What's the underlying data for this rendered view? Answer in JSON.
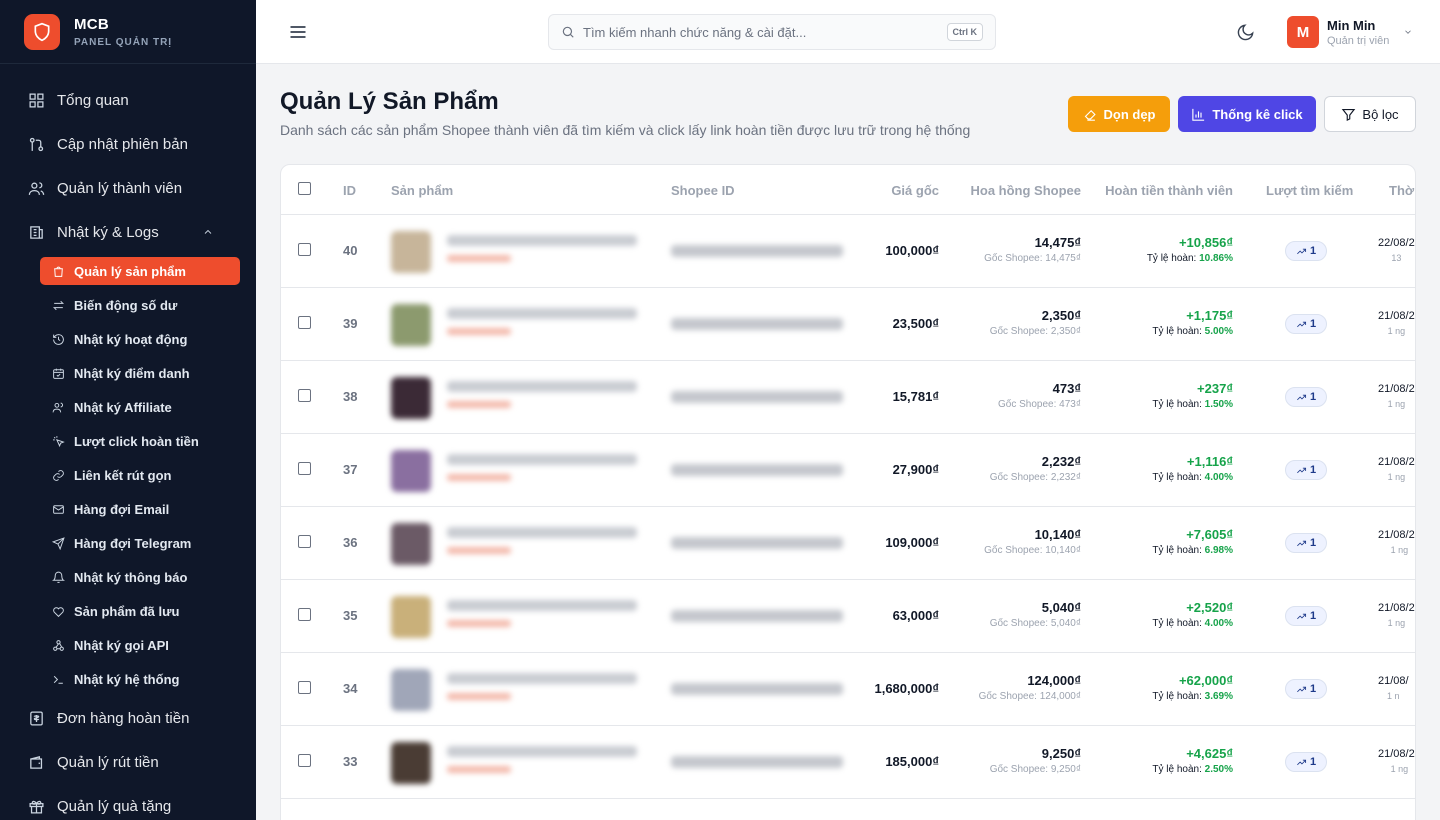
{
  "brand": {
    "name": "MCB",
    "subtitle": "PANEL QUẢN TRỊ"
  },
  "sidebar": {
    "items": [
      {
        "label": "Tổng quan",
        "icon": "dashboard-icon"
      },
      {
        "label": "Cập nhật phiên bản",
        "icon": "git-icon"
      },
      {
        "label": "Quản lý thành viên",
        "icon": "users-icon"
      },
      {
        "label": "Nhật ký & Logs",
        "icon": "logs-icon",
        "expanded": true
      }
    ],
    "sub_items": [
      {
        "label": "Quản lý sản phẩm",
        "icon": "shopping-bag-icon",
        "active": true
      },
      {
        "label": "Biến động số dư",
        "icon": "arrows-icon"
      },
      {
        "label": "Nhật ký hoạt động",
        "icon": "history-icon"
      },
      {
        "label": "Nhật ký điểm danh",
        "icon": "calendar-check-icon"
      },
      {
        "label": "Nhật ký Affiliate",
        "icon": "user-icon"
      },
      {
        "label": "Lượt click hoàn tiền",
        "icon": "click-icon"
      },
      {
        "label": "Liên kết rút gọn",
        "icon": "link-icon"
      },
      {
        "label": "Hàng đợi Email",
        "icon": "mail-icon"
      },
      {
        "label": "Hàng đợi Telegram",
        "icon": "send-icon"
      },
      {
        "label": "Nhật ký thông báo",
        "icon": "bell-icon"
      },
      {
        "label": "Sản phẩm đã lưu",
        "icon": "heart-icon"
      },
      {
        "label": "Nhật ký gọi API",
        "icon": "webhook-icon"
      },
      {
        "label": "Nhật ký hệ thống",
        "icon": "terminal-icon"
      }
    ],
    "bottom_items": [
      {
        "label": "Đơn hàng hoàn tiền",
        "icon": "receipt-icon"
      },
      {
        "label": "Quản lý rút tiền",
        "icon": "wallet-icon"
      },
      {
        "label": "Quản lý quà tặng",
        "icon": "gift-icon"
      }
    ]
  },
  "header": {
    "search_placeholder": "Tìm kiếm nhanh chức năng & cài đặt...",
    "shortcut": "Ctrl K",
    "user": {
      "initial": "M",
      "name": "Min Min",
      "role": "Quản trị viên"
    }
  },
  "page": {
    "title": "Quản Lý Sản Phẩm",
    "description": "Danh sách các sản phẩm Shopee thành viên đã tìm kiếm và click lấy link hoàn tiền được lưu trữ trong hệ thống",
    "buttons": {
      "clean": "Dọn dẹp",
      "stats": "Thống kê click",
      "filter": "Bộ lọc"
    }
  },
  "table": {
    "columns": {
      "id": "ID",
      "product": "Sản phẩm",
      "shopee_id": "Shopee ID",
      "price": "Giá gốc",
      "commission": "Hoa hồng Shopee",
      "refund": "Hoàn tiền thành viên",
      "views": "Lượt tìm kiếm",
      "time": "Thời"
    },
    "commission_prefix": "Gốc Shopee: ",
    "refund_rate_label": "Tỷ lệ hoàn: ",
    "rows": [
      {
        "id": "40",
        "price": "100,000₫",
        "commission": "14,475₫",
        "commission_base": "14,475₫",
        "refund": "+10,856₫",
        "refund_rate": "10.86%",
        "views": "1",
        "time": "22/08/2",
        "time_ago": "13",
        "thumb_color": "#c7b59a"
      },
      {
        "id": "39",
        "price": "23,500₫",
        "commission": "2,350₫",
        "commission_base": "2,350₫",
        "refund": "+1,175₫",
        "refund_rate": "5.00%",
        "views": "1",
        "time": "21/08/2",
        "time_ago": "1 ng",
        "thumb_color": "#8c9a6e"
      },
      {
        "id": "38",
        "price": "15,781₫",
        "commission": "473₫",
        "commission_base": "473₫",
        "refund": "+237₫",
        "refund_rate": "1.50%",
        "views": "1",
        "time": "21/08/2",
        "time_ago": "1 ng",
        "thumb_color": "#3b2a36"
      },
      {
        "id": "37",
        "price": "27,900₫",
        "commission": "2,232₫",
        "commission_base": "2,232₫",
        "refund": "+1,116₫",
        "refund_rate": "4.00%",
        "views": "1",
        "time": "21/08/2",
        "time_ago": "1 ng",
        "thumb_color": "#8a6fa0"
      },
      {
        "id": "36",
        "price": "109,000₫",
        "commission": "10,140₫",
        "commission_base": "10,140₫",
        "refund": "+7,605₫",
        "refund_rate": "6.98%",
        "views": "1",
        "time": "21/08/20",
        "time_ago": "1 ng",
        "thumb_color": "#6b5a66"
      },
      {
        "id": "35",
        "price": "63,000₫",
        "commission": "5,040₫",
        "commission_base": "5,040₫",
        "refund": "+2,520₫",
        "refund_rate": "4.00%",
        "views": "1",
        "time": "21/08/2",
        "time_ago": "1 ng",
        "thumb_color": "#c9b07a"
      },
      {
        "id": "34",
        "price": "1,680,000₫",
        "commission": "124,000₫",
        "commission_base": "124,000₫",
        "refund": "+62,000₫",
        "refund_rate": "3.69%",
        "views": "1",
        "time": "21/08/",
        "time_ago": "1 n",
        "thumb_color": "#a0a6b8"
      },
      {
        "id": "33",
        "price": "185,000₫",
        "commission": "9,250₫",
        "commission_base": "9,250₫",
        "refund": "+4,625₫",
        "refund_rate": "2.50%",
        "views": "1",
        "time": "21/08/20",
        "time_ago": "1 ng",
        "thumb_color": "#4a3c34"
      }
    ]
  }
}
